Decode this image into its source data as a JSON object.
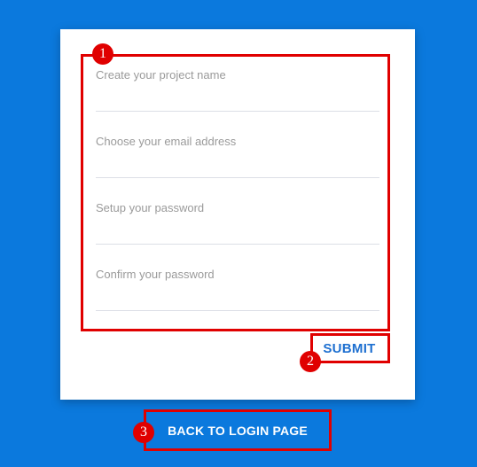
{
  "form": {
    "fields": [
      {
        "label": "Create your project name",
        "value": ""
      },
      {
        "label": "Choose your email address",
        "value": ""
      },
      {
        "label": "Setup your password",
        "value": ""
      },
      {
        "label": "Confirm your password",
        "value": ""
      }
    ],
    "submit_label": "SUBMIT"
  },
  "footer": {
    "back_label": "BACK TO LOGIN PAGE"
  },
  "annotations": [
    {
      "number": "1"
    },
    {
      "number": "2"
    },
    {
      "number": "3"
    }
  ],
  "colors": {
    "background": "#0b79dd",
    "card": "#ffffff",
    "accent": "#1d6fd0",
    "annotation": "#e00000"
  }
}
